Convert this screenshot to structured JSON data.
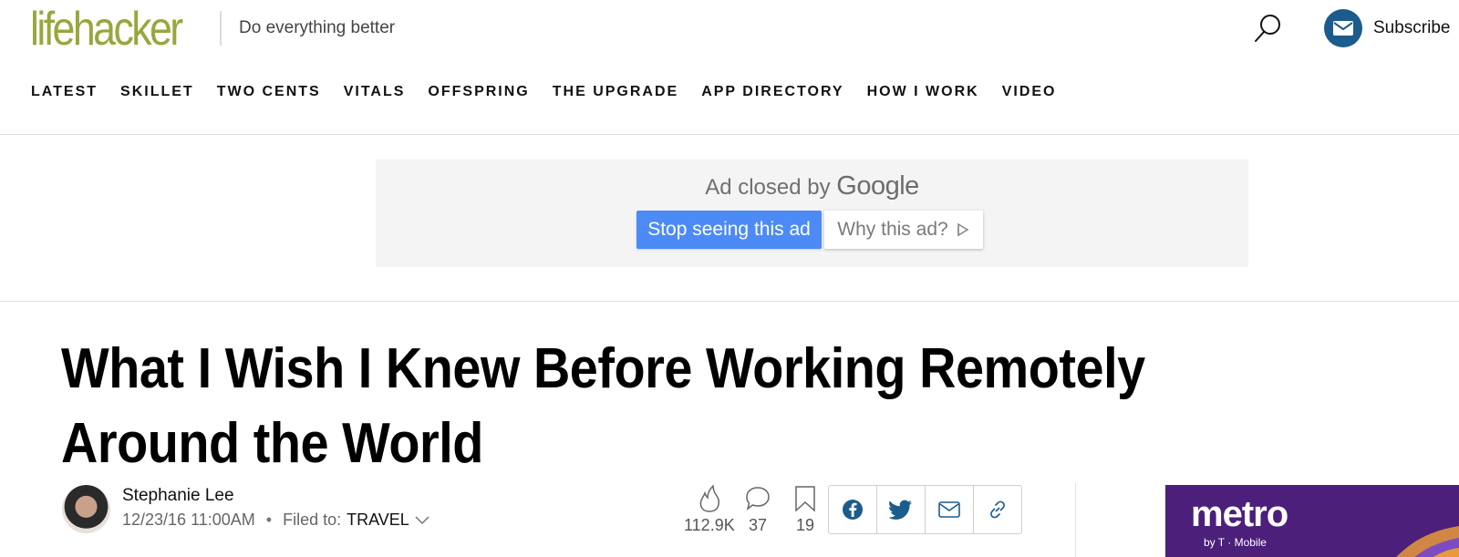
{
  "header": {
    "logo_part1": "life",
    "logo_part2": "hacker",
    "tagline": "Do everything better",
    "subscribe_label": "Subscribe"
  },
  "nav": {
    "items": [
      "LATEST",
      "SKILLET",
      "TWO CENTS",
      "VITALS",
      "OFFSPRING",
      "THE UPGRADE",
      "APP DIRECTORY",
      "HOW I WORK",
      "VIDEO"
    ]
  },
  "ad": {
    "closed_text": "Ad closed by",
    "google_text": "Google",
    "stop_label": "Stop seeing this ad",
    "why_label": "Why this ad?"
  },
  "article": {
    "title": "What I Wish I Knew Before Working Remotely Around the World",
    "author": "Stephanie Lee",
    "date": "12/23/16 11:00AM",
    "filed_label": "Filed to:",
    "category": "TRAVEL"
  },
  "stats": {
    "views": "112.9K",
    "comments": "37",
    "saves": "19"
  },
  "side_ad": {
    "brand": "metro",
    "sub": "by T · Mobile"
  },
  "colors": {
    "logo": "#9aa63c",
    "subscribe_icon_bg": "#1c5c8c",
    "ad_stop_bg": "#4c8bf5",
    "metro_bg": "#4b1f7a"
  },
  "icons": {
    "search": "search-icon",
    "mail": "mail-icon",
    "flame": "flame-icon",
    "comment": "comment-icon",
    "bookmark": "bookmark-icon",
    "facebook": "facebook-icon",
    "twitter": "twitter-icon",
    "email": "email-icon",
    "link": "link-icon",
    "chevron": "chevron-down-icon",
    "ad_choices": "ad-choices-icon"
  }
}
